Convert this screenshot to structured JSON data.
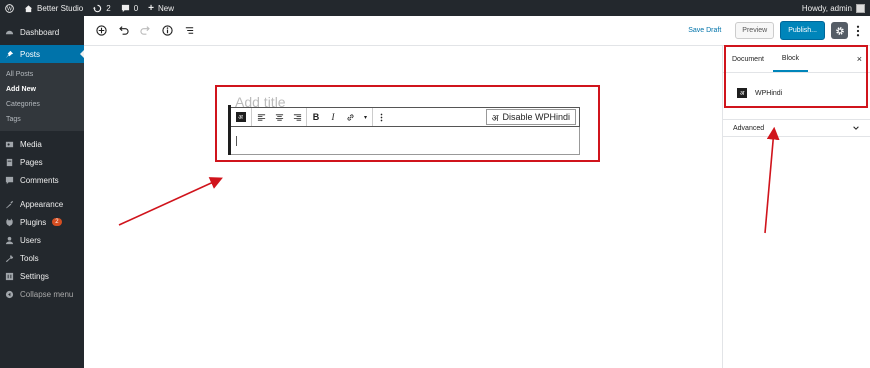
{
  "adminbar": {
    "site_name": "Better Studio",
    "updates_count": "2",
    "comments_count": "0",
    "new_label": "New",
    "greeting": "Howdy, admin"
  },
  "sidebar": {
    "items": [
      {
        "label": "Dashboard",
        "icon": "dashboard-icon"
      },
      {
        "label": "Posts",
        "icon": "pin-icon"
      },
      {
        "label": "Media",
        "icon": "media-icon"
      },
      {
        "label": "Pages",
        "icon": "pages-icon"
      },
      {
        "label": "Comments",
        "icon": "comments-icon"
      },
      {
        "label": "Appearance",
        "icon": "appearance-icon"
      },
      {
        "label": "Plugins",
        "icon": "plugins-icon",
        "badge": "2"
      },
      {
        "label": "Users",
        "icon": "users-icon"
      },
      {
        "label": "Tools",
        "icon": "tools-icon"
      },
      {
        "label": "Settings",
        "icon": "settings-icon"
      },
      {
        "label": "Collapse menu",
        "icon": "collapse-icon"
      }
    ],
    "posts_submenu": [
      "All Posts",
      "Add New",
      "Categories",
      "Tags"
    ]
  },
  "editor_toolbar": {
    "save_draft": "Save Draft",
    "preview": "Preview",
    "publish": "Publish..."
  },
  "canvas": {
    "title_placeholder": "Add title",
    "disable_button": "Disable WPHindi",
    "disable_glyph": "अ"
  },
  "inspector": {
    "tab_document": "Document",
    "tab_block": "Block",
    "close": "×",
    "block_name": "WPHindi",
    "advanced": "Advanced"
  },
  "colors": {
    "admin_dark": "#23282d",
    "wp_blue": "#0073aa",
    "highlight_red": "#d0141c"
  }
}
